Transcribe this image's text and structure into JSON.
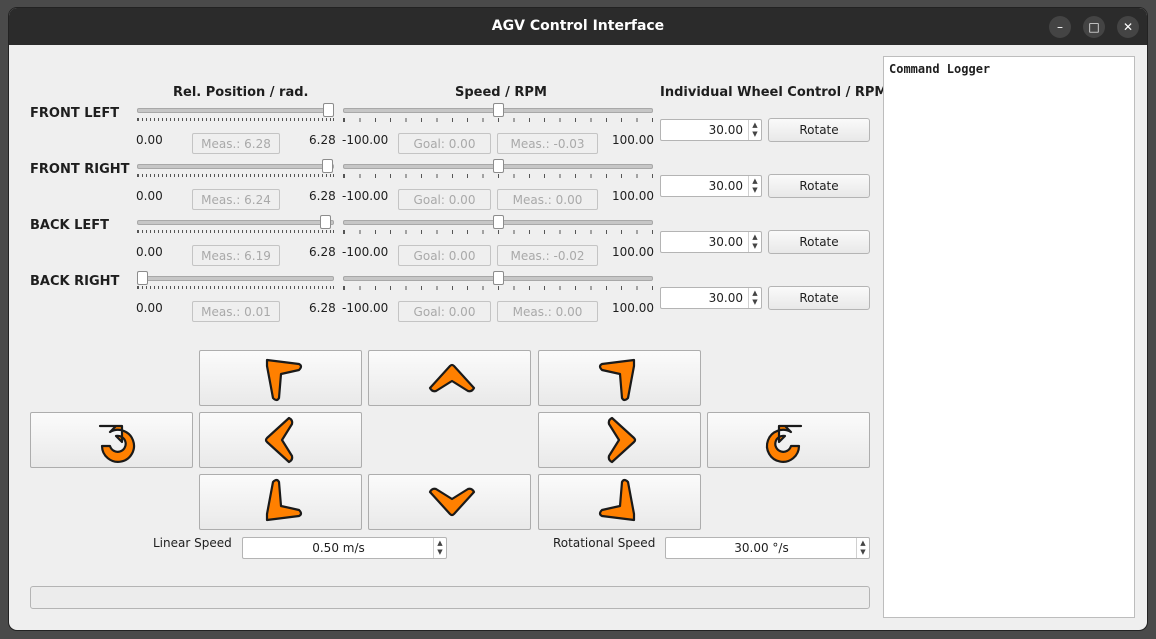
{
  "window": {
    "title": "AGV Control Interface"
  },
  "headers": {
    "position": "Rel. Position / rad.",
    "speed": "Speed / RPM",
    "wheel_control": "Individual Wheel Control / RPM"
  },
  "ranges": {
    "pos_min": "0.00",
    "pos_max": "6.28",
    "speed_min": "-100.00",
    "speed_max": "100.00"
  },
  "wheels": [
    {
      "label": "FRONT LEFT",
      "position_level": 1.0,
      "speed_level": 0.5,
      "pos_meas": "Meas.: 6.28",
      "speed_goal": "Goal: 0.00",
      "speed_meas": "Meas.: -0.03",
      "rpm": "30.00",
      "button": "Rotate"
    },
    {
      "label": "FRONT RIGHT",
      "position_level": 0.993,
      "speed_level": 0.5,
      "pos_meas": "Meas.: 6.24",
      "speed_goal": "Goal: 0.00",
      "speed_meas": "Meas.: 0.00",
      "rpm": "30.00",
      "button": "Rotate"
    },
    {
      "label": "BACK LEFT",
      "position_level": 0.986,
      "speed_level": 0.5,
      "pos_meas": "Meas.: 6.19",
      "speed_goal": "Goal: 0.00",
      "speed_meas": "Meas.: -0.02",
      "rpm": "30.00",
      "button": "Rotate"
    },
    {
      "label": "BACK RIGHT",
      "position_level": 0.002,
      "speed_level": 0.5,
      "pos_meas": "Meas.: 0.01",
      "speed_goal": "Goal: 0.00",
      "speed_meas": "Meas.: 0.00",
      "rpm": "30.00",
      "button": "Rotate"
    }
  ],
  "motion_buttons": [
    "arrow-forward-left-icon",
    "arrow-up-icon",
    "arrow-forward-right-icon",
    "rotate-counterclockwise-icon",
    "arrow-left-icon",
    "arrow-right-icon",
    "rotate-clockwise-icon",
    "arrow-back-left-icon",
    "arrow-down-icon",
    "arrow-back-right-icon"
  ],
  "speed_controls": {
    "linear_label": "Linear Speed",
    "linear_value": "0.50 m/s",
    "rotational_label": "Rotational Speed",
    "rotational_value": "30.00 °/s"
  },
  "logger": {
    "title": "Command Logger"
  },
  "colors": {
    "accent": "#ff8000",
    "outline": "#1a1a1a",
    "titlebar": "#2b2b2b"
  }
}
